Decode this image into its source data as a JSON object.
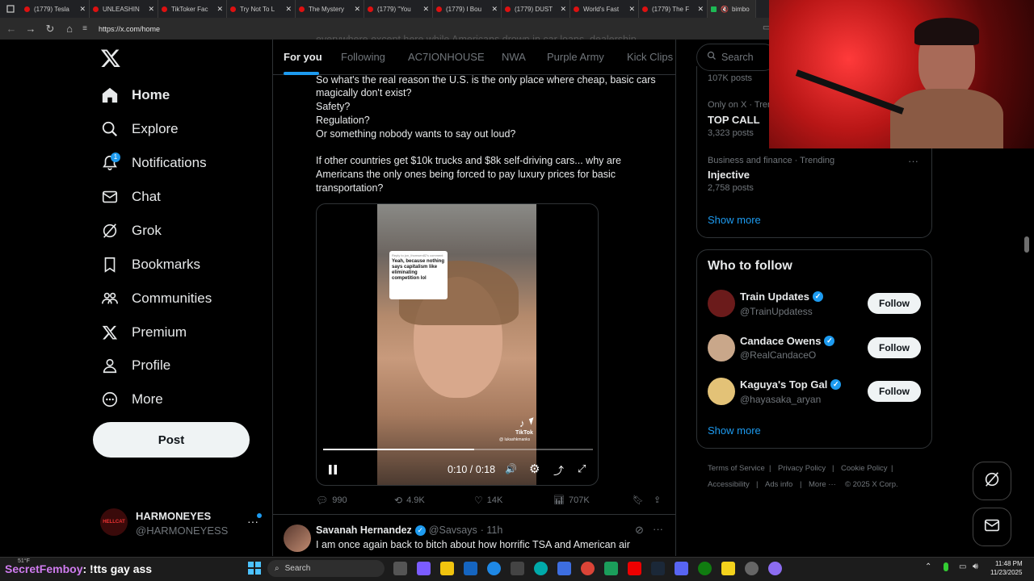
{
  "browser": {
    "tabs": [
      "(1779) Tesla",
      "UNLEASHIN",
      "TikToker Fac",
      "Try Not To L",
      "The Mystery",
      "(1779) \"You",
      "(1779) I Bou",
      "(1779) DUST",
      "World's Fast",
      "(1779) The F",
      "bimbo"
    ],
    "url": "https://x.com/home"
  },
  "sidebar": {
    "items": [
      {
        "label": "Home",
        "icon": "home-icon"
      },
      {
        "label": "Explore",
        "icon": "search-icon"
      },
      {
        "label": "Notifications",
        "icon": "bell-icon",
        "badge": "1"
      },
      {
        "label": "Chat",
        "icon": "mail-icon"
      },
      {
        "label": "Grok",
        "icon": "grok-icon"
      },
      {
        "label": "Bookmarks",
        "icon": "bookmark-icon"
      },
      {
        "label": "Communities",
        "icon": "communities-icon"
      },
      {
        "label": "Premium",
        "icon": "x-logo-icon"
      },
      {
        "label": "Profile",
        "icon": "person-icon"
      },
      {
        "label": "More",
        "icon": "more-circle-icon"
      }
    ],
    "post_label": "Post",
    "account": {
      "name": "HARMONEYES",
      "handle": "@HARMONEYESS",
      "avatar_text": "HELLCAT"
    }
  },
  "feed": {
    "tabs": [
      "For you",
      "Following",
      "AC7IONHOUSE",
      "NWA",
      "Purple Army",
      "Kick Clips"
    ],
    "active_tab": "For you",
    "cut_line": "everywhere except here while Americans drown in car loans, dealership",
    "tweet_lines": [
      "So what's the real reason the U.S. is the only place where cheap, basic cars",
      "magically don't exist?",
      "Safety?",
      "Regulation?",
      "Or something nobody wants to say out loud?",
      "",
      "If other countries get $10k trucks and $8k self-driving cars... why are",
      "Americans the only ones being forced to pay luxury prices for basic",
      "transportation?"
    ],
    "video": {
      "caption_reply": "Reply to jon_thomsen82's comment",
      "caption_text": "Yeah, because nothing says capitalism like eliminating competition lol",
      "watermark": "TikTok",
      "watermark_handle": "@ lukashkmanks",
      "time": "0:10 / 0:18",
      "progress": 0.56
    },
    "actions": {
      "replies": "990",
      "reposts": "4.9K",
      "likes": "14K",
      "views": "707K"
    },
    "next_tweet": {
      "name": "Savanah Hernandez",
      "handle": "@Savsays",
      "time": "· 11h",
      "text": "I am once again back to bitch about how horrific TSA and American air"
    }
  },
  "right": {
    "search_placeholder": "Search",
    "trends": [
      {
        "meta": "",
        "topic": "",
        "posts": "107K posts"
      },
      {
        "meta": "Only on X · Trending",
        "topic": "TOP CALL",
        "posts": "3,323 posts"
      },
      {
        "meta": "Business and finance · Trending",
        "topic": "Injective",
        "posts": "2,758 posts"
      }
    ],
    "show_more": "Show more",
    "who_to_follow_title": "Who to follow",
    "follow_suggestions": [
      {
        "name": "Train Updates",
        "handle": "@TrainUpdatess",
        "color": "#6b1b1b"
      },
      {
        "name": "Candace Owens",
        "handle": "@RealCandaceO",
        "color": "#c9a78a"
      },
      {
        "name": "Kaguya's Top Gal",
        "handle": "@hayasaka_aryan",
        "color": "#e3c277"
      }
    ],
    "follow_label": "Follow",
    "footer": [
      "Terms of Service",
      "|",
      "Privacy Policy",
      "|",
      "Cookie Policy",
      "|",
      "Accessibility",
      "|",
      "Ads info",
      "|",
      "More ···",
      "© 2025 X Corp."
    ]
  },
  "stream_overlay": {
    "chat_user": "SecretFemboy",
    "chat_message": ": !tts gay ass",
    "weather": "51°F"
  },
  "taskbar": {
    "search_placeholder": "Search",
    "time": "11:48 PM",
    "date": "11/23/2025"
  },
  "colors": {
    "accent": "#1d9bf0",
    "background": "#000000",
    "border": "#2f3336"
  }
}
